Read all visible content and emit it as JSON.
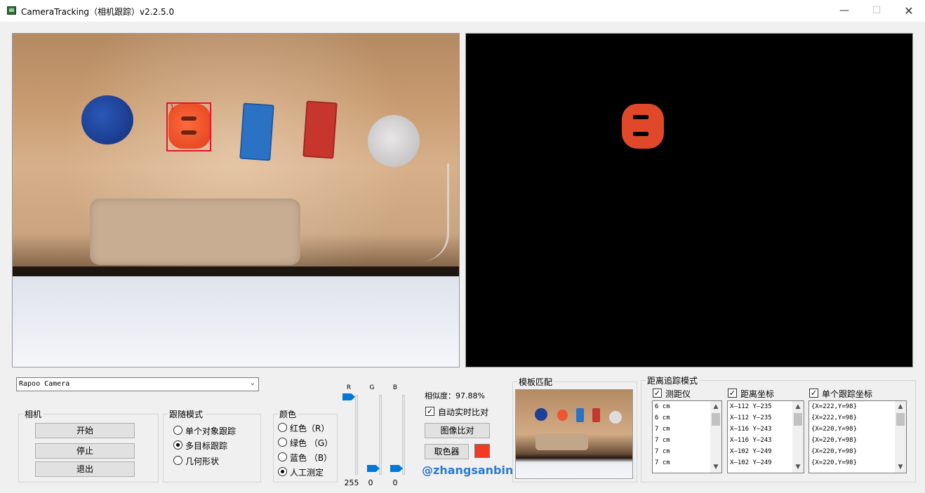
{
  "window": {
    "title": "CameraTracking（相机跟踪）v2.2.5.0",
    "minimize_glyph": "—",
    "maximize_glyph": "☐",
    "close_glyph": "✕"
  },
  "camera_view": {
    "tracked_object_id": "1"
  },
  "camera_select": {
    "value": "Rapoo Camera"
  },
  "camera_group": {
    "legend": "相机",
    "start_label": "开始",
    "stop_label": "停止",
    "exit_label": "退出"
  },
  "tracking_mode": {
    "legend": "跟随模式",
    "options": [
      {
        "label": "单个对象跟踪",
        "selected": false
      },
      {
        "label": "多目标跟踪",
        "selected": true
      },
      {
        "label": "几何形状",
        "selected": false
      }
    ]
  },
  "color_group": {
    "legend": "颜色",
    "options": [
      {
        "label": "红色（R）",
        "selected": false
      },
      {
        "label": "绿色 （G）",
        "selected": false
      },
      {
        "label": "蓝色 （B）",
        "selected": false
      },
      {
        "label": "人工测定",
        "selected": true
      }
    ]
  },
  "rgb_sliders": [
    {
      "label": "R",
      "value": "255",
      "level": 1.0
    },
    {
      "label": "G",
      "value": "0",
      "level": 0.0
    },
    {
      "label": "B",
      "value": "0",
      "level": 0.0
    }
  ],
  "compare": {
    "similarity_text": "相似度：97.88%",
    "auto_compare_label": "自动实时比对",
    "auto_compare_checked": true,
    "image_compare_label": "图像比对",
    "color_picker_label": "取色器",
    "picked_color": "#f33a22"
  },
  "watermark": "@zhangsanbin",
  "template_group": {
    "legend": "模板匹配"
  },
  "distance_group": {
    "legend": "距离追踪模式",
    "columns": [
      {
        "label": "测距仪",
        "checked": true,
        "items": [
          "6  cm",
          "6  cm",
          "7  cm",
          "7  cm",
          "7  cm",
          "7  cm"
        ]
      },
      {
        "label": "距离坐标",
        "checked": true,
        "items": [
          "X—112  Y—235",
          "X—112  Y—235",
          "X—116  Y—243",
          "X—116  Y—243",
          "X—102  Y—249",
          "X—102  Y—249"
        ]
      },
      {
        "label": "单个跟踪坐标",
        "checked": true,
        "items": [
          "{X=222,Y=98}",
          "{X=222,Y=98}",
          "{X=220,Y=98}",
          "{X=220,Y=98}",
          "{X=220,Y=98}",
          "{X=220,Y=98}"
        ]
      }
    ]
  },
  "colors": {
    "accent": "#0078d7",
    "tracking_box": "#e0182a",
    "watermark": "#2b7bd0"
  }
}
